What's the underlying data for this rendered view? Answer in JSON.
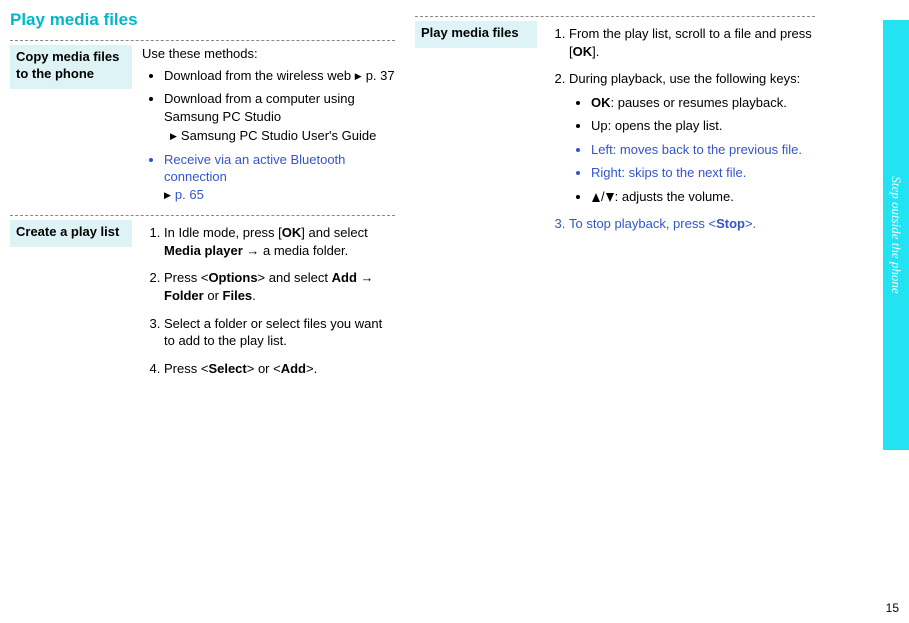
{
  "title": "Play media files",
  "side_tab": "Step outside the phone",
  "page_number": "15",
  "left": {
    "section1": {
      "label": "Copy media files to the phone",
      "intro": "Use these methods:",
      "b1": "Download from the wireless web",
      "b1_ref": "p. 37",
      "b2": "Download from a computer using Samsung PC Studio",
      "b2_sub": "Samsung PC Studio User's Guide",
      "b3": "Receive via an active Bluetooth connection",
      "b3_ref": "p. 65"
    },
    "section2": {
      "label": "Create a play list",
      "s1a": "In Idle mode, press [",
      "s1_ok": "OK",
      "s1b": "] and select ",
      "s1_mp": "Media player",
      "s1c": " → a media folder.",
      "s2a": "Press <",
      "s2_opt": "Options",
      "s2b": "> and select ",
      "s2_add": "Add",
      "s2c": " → ",
      "s2_folder": "Folder",
      "s2d": " or ",
      "s2_files": "Files",
      "s2e": ".",
      "s3": "Select a folder or select files you want to add to the play list.",
      "s4a": "Press <",
      "s4_sel": "Select",
      "s4b": "> or <",
      "s4_add": "Add",
      "s4c": ">."
    }
  },
  "right": {
    "label": "Play media files",
    "s1a": "From the play list, scroll to a file and press [",
    "s1_ok": "OK",
    "s1b": "].",
    "s2": "During playback, use the following keys:",
    "k1_ok": "OK",
    "k1": ": pauses or resumes playback.",
    "k2": "Up: opens the play list.",
    "k3": "Left: moves back to the previous file.",
    "k4": "Right: skips to the next file.",
    "k5a": "/",
    "k5b": ": adjusts the volume.",
    "s3a": "To stop playback, press <",
    "s3_stop": "Stop",
    "s3b": ">."
  }
}
